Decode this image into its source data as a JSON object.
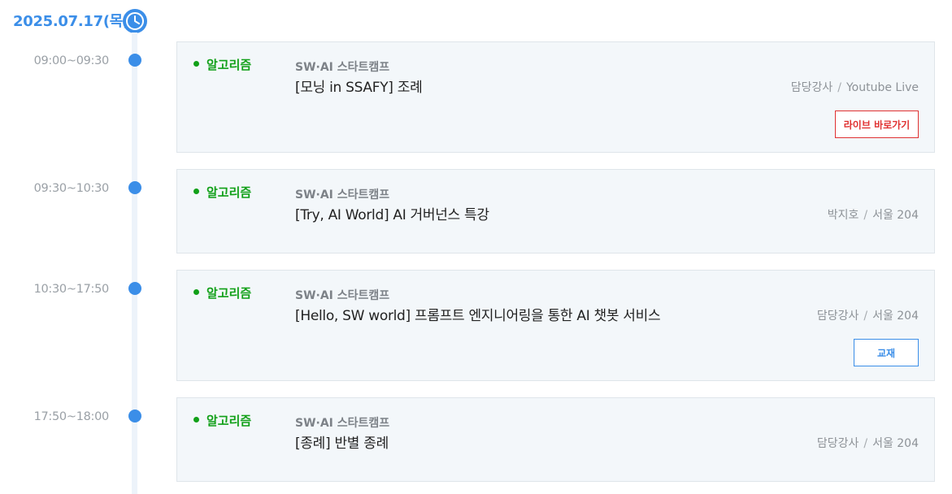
{
  "header": {
    "date": "2025.07.17(목)",
    "clock_icon": "clock-icon",
    "accent_color": "#3b8ee8"
  },
  "sessions": [
    {
      "time": "09:00~09:30",
      "category": "알고리즘",
      "program": "SW·AI 스타트캠프",
      "title": "[모닝 in SSAFY] 조례",
      "instructor": "담당강사",
      "separator": "/",
      "location": "Youtube Live",
      "button": "라이브 바로가기"
    },
    {
      "time": "09:30~10:30",
      "category": "알고리즘",
      "program": "SW·AI 스타트캠프",
      "title": "[Try, AI World] AI 거버넌스 특강",
      "instructor": "박지호",
      "separator": "/",
      "location": "서울 204"
    },
    {
      "time": "10:30~17:50",
      "category": "알고리즘",
      "program": "SW·AI 스타트캠프",
      "title": "[Hello, SW world] 프롬프트 엔지니어링을 통한 AI 챗봇 서비스",
      "instructor": "담당강사",
      "separator": "/",
      "location": "서울 204",
      "button": "교재"
    },
    {
      "time": "17:50~18:00",
      "category": "알고리즘",
      "program": "SW·AI 스타트캠프",
      "title": "[종례] 반별 종례",
      "instructor": "담당강사",
      "separator": "/",
      "location": "서울 204"
    }
  ]
}
